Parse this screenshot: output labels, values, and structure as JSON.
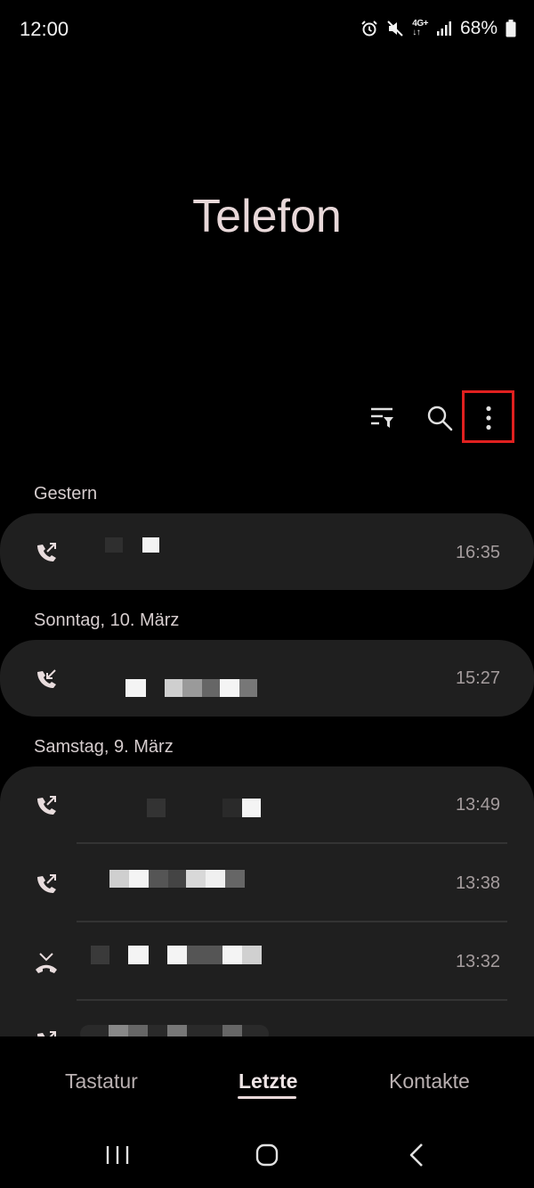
{
  "status_bar": {
    "time": "12:00",
    "network": "4G+",
    "battery": "68%",
    "icons": [
      "alarm-icon",
      "mute-icon",
      "network-4g-icon",
      "signal-icon",
      "battery-icon"
    ]
  },
  "app": {
    "title": "Telefon"
  },
  "toolbar": {
    "icons": [
      "filter-icon",
      "search-icon",
      "more-options-icon"
    ]
  },
  "sections": [
    {
      "header": "Gestern",
      "calls": [
        {
          "type": "outgoing",
          "time": "16:35"
        }
      ]
    },
    {
      "header": "Sonntag, 10. März",
      "calls": [
        {
          "type": "incoming",
          "time": "15:27"
        }
      ]
    },
    {
      "header": "Samstag, 9. März",
      "calls": [
        {
          "type": "outgoing",
          "time": "13:49"
        },
        {
          "type": "outgoing",
          "time": "13:38"
        },
        {
          "type": "rejected",
          "time": "13:32"
        },
        {
          "type": "outgoing",
          "time": ""
        }
      ]
    }
  ],
  "tabs": {
    "keypad": "Tastatur",
    "recents": "Letzte",
    "contacts": "Kontakte",
    "active": "recents"
  },
  "nav": {
    "icons": [
      "recent-apps-icon",
      "home-icon",
      "back-icon"
    ]
  },
  "colors": {
    "background": "#000000",
    "card": "#1f1f1f",
    "highlight": "#e0201f",
    "title": "#e8d8d9"
  }
}
